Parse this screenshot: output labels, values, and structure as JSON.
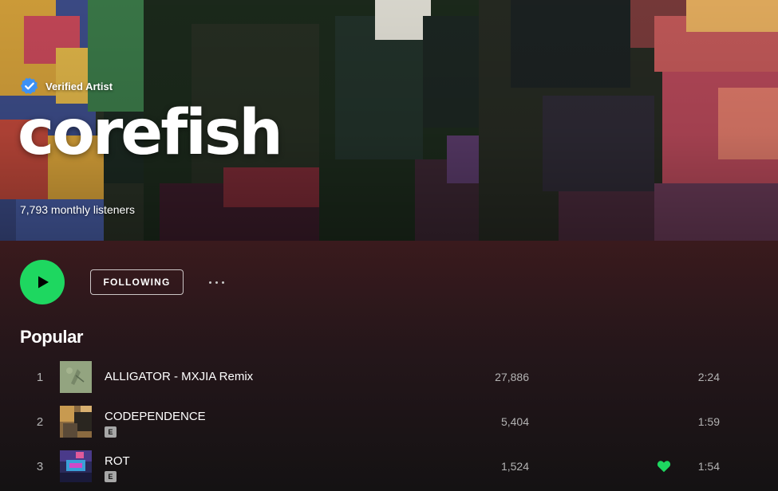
{
  "hero": {
    "verified_label": "Verified Artist",
    "artist_name": "corefish",
    "monthly_listeners": "7,793 monthly listeners"
  },
  "actions": {
    "follow_label": "FOLLOWING",
    "play_icon": "play-icon",
    "more_icon": "more-options-icon"
  },
  "popular": {
    "title": "Popular",
    "tracks": [
      {
        "number": "1",
        "title": "ALLIGATOR - MXJIA Remix",
        "explicit": false,
        "plays": "27,886",
        "liked": false,
        "duration": "2:24"
      },
      {
        "number": "2",
        "title": "CODEPENDENCE",
        "explicit": true,
        "explicit_label": "E",
        "plays": "5,404",
        "liked": false,
        "duration": "1:59"
      },
      {
        "number": "3",
        "title": "ROT",
        "explicit": true,
        "explicit_label": "E",
        "plays": "1,524",
        "liked": true,
        "duration": "1:54"
      }
    ]
  },
  "colors": {
    "accent": "#1ed760",
    "verified_badge": "#3d91f4",
    "background": "#121212"
  }
}
